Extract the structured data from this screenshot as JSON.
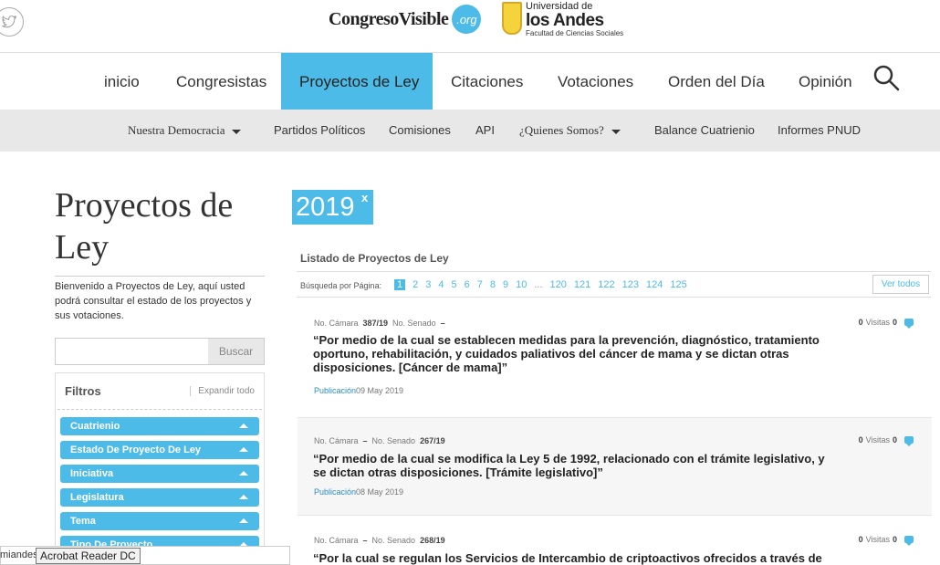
{
  "header": {
    "site_name": "CongresoVisible",
    "site_tld": ".org",
    "partner_line1": "Universidad de",
    "partner_line2": "los Andes",
    "partner_line3": "Facultad de Ciencias Sociales"
  },
  "main_nav": {
    "items": [
      {
        "label": "inicio"
      },
      {
        "label": "Congresistas"
      },
      {
        "label": "Proyectos de Ley",
        "active": true
      },
      {
        "label": "Citaciones"
      },
      {
        "label": "Votaciones"
      },
      {
        "label": "Orden del Día"
      },
      {
        "label": "Opinión"
      }
    ]
  },
  "sub_nav": {
    "items": [
      {
        "label": "Nuestra Democracia",
        "dropdown": true
      },
      {
        "label": "Partidos Políticos"
      },
      {
        "label": "Comisiones"
      },
      {
        "label": "API"
      },
      {
        "label": "¿Quienes Somos?",
        "dropdown": true
      },
      {
        "label": "Balance Cuatrienio"
      },
      {
        "label": "Informes PNUD"
      }
    ]
  },
  "sidebar": {
    "title": "Proyectos de Ley",
    "intro": "Bienvenido a Proyectos de Ley, aquí usted podrá consultar el estado de los proyectos y sus votaciones.",
    "search_value": "",
    "search_button": "Buscar",
    "filters_title": "Filtros",
    "expand_all": "Expandir todo",
    "filters": [
      "Cuatrienio",
      "Estado De Proyecto De Ley",
      "Iniciativa",
      "Legislatura",
      "Tema",
      "Tipo De Proyecto"
    ]
  },
  "content": {
    "year_tag": "2019",
    "year_tag_close": "x",
    "list_title": "Listado de Proyectos de Ley",
    "pager_label": "Búsqueda por Página:",
    "pages": [
      "1",
      "2",
      "3",
      "4",
      "5",
      "6",
      "7",
      "8",
      "9",
      "10",
      "...",
      "120",
      "121",
      "122",
      "123",
      "124",
      "125"
    ],
    "current_page": "1",
    "view_all": "Ver todos",
    "projects": [
      {
        "camara_label": "No. Cámara",
        "camara": "387/19",
        "senado_label": "No. Senado",
        "senado": "–",
        "visits": "0",
        "visits_label": "Visitas",
        "comments": "0",
        "title": "“Por medio de la cual se establecen medidas para la prevención, diagnóstico, tratamiento oportuno, rehabilitación, y cuidados paliativos del cáncer de mama y se dictan otras disposiciones. [Cáncer de mama]”",
        "pub_label": "Publicación",
        "pub_date": "09 May 2019"
      },
      {
        "camara_label": "No. Cámara",
        "camara": "–",
        "senado_label": "No. Senado",
        "senado": "267/19",
        "visits": "0",
        "visits_label": "Visitas",
        "comments": "0",
        "title": "“Por medio de la cual se modifica la Ley 5 de 1992, relacionado con el trámite legislativo, y se dictan otras disposiciones. [Trámite legislativo]”",
        "pub_label": "Publicación",
        "pub_date": "08 May 2019"
      },
      {
        "camara_label": "No. Cámara",
        "camara": "–",
        "senado_label": "No. Senado",
        "senado": "268/19",
        "visits": "0",
        "visits_label": "Visitas",
        "comments": "0",
        "title": "“Por la cual se regulan los Servicios de Intercambio de criptoactivos ofrecidos a través de",
        "pub_label": "",
        "pub_date": ""
      }
    ]
  },
  "taskbar": {
    "cut_text": "miandes",
    "tooltip": "Acrobat Reader DC"
  },
  "colors": {
    "accent": "#4dbbe8",
    "subnav_bg": "#e8e8e8"
  }
}
